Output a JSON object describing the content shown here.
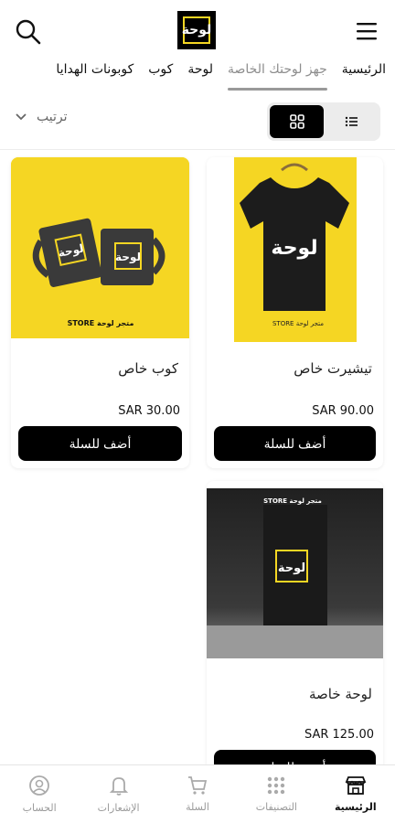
{
  "header": {
    "logo_text": "لوحة"
  },
  "tabs": [
    {
      "label": "الرئيسية",
      "active": false
    },
    {
      "label": "جهز لوحتك الخاصة",
      "active": true
    },
    {
      "label": "لوحة",
      "active": false
    },
    {
      "label": "كوب",
      "active": false
    },
    {
      "label": "كوبونات الهدايا",
      "active": false
    }
  ],
  "toolbar": {
    "sort_label": "ترتيب"
  },
  "products": [
    {
      "title": "تيشيرت خاص",
      "price": "SAR 90.00",
      "button": "أضف للسلة",
      "store_label": "STORE متجر لوحة",
      "image_text": "لوحة"
    },
    {
      "title": "كوب خاص",
      "price": "SAR 30.00",
      "button": "أضف للسلة",
      "store_label": "STORE متجر لوحة",
      "image_text": "لوحة"
    },
    {
      "title": "لوحة خاصة",
      "price": "SAR 125.00",
      "button": "أضف للسلة",
      "store_label": "STORE متجر لوحة",
      "image_text": "لوحة"
    }
  ],
  "bottom_nav": [
    {
      "label": "الرئيسية",
      "icon": "store-icon",
      "active": true
    },
    {
      "label": "التصنيفات",
      "icon": "grid-dots-icon",
      "active": false
    },
    {
      "label": "السلة",
      "icon": "cart-icon",
      "active": false
    },
    {
      "label": "الإشعارات",
      "icon": "bell-icon",
      "active": false
    },
    {
      "label": "الحساب",
      "icon": "user-icon",
      "active": false
    }
  ],
  "colors": {
    "brand_yellow": "#f5d623",
    "black": "#000000"
  }
}
